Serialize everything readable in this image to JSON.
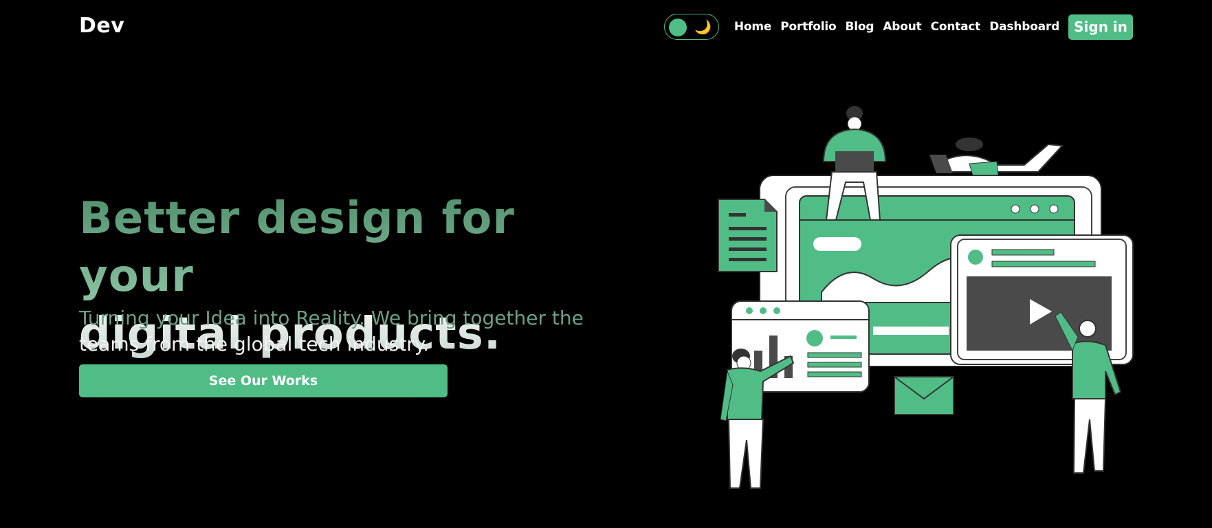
{
  "brand": {
    "logo_text": "Dev"
  },
  "theme_toggle": {
    "icon": "moon-icon",
    "glyph": "🌙"
  },
  "nav": {
    "links": [
      "Home",
      "Portfolio",
      "Blog",
      "About",
      "Contact",
      "Dashboard"
    ],
    "signin_label": "Sign in"
  },
  "hero": {
    "title_line1": "Better design for your",
    "title_line2": "digital products.",
    "subtitle_part1": "Turning your Idea into Reality. We bring together the",
    "subtitle_part2": "teams from the global tech industry.",
    "cta_label": "See Our Works"
  },
  "colors": {
    "accent": "#51bd86",
    "background": "#000000",
    "dark_gray": "#4a4a4a"
  }
}
